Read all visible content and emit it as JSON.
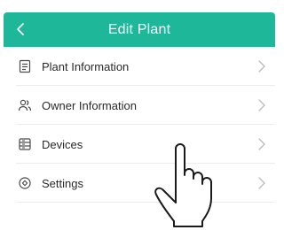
{
  "colors": {
    "accent": "#1fb79a",
    "icon": "#4a4a4a",
    "chevron": "#bdbdbd",
    "divider": "#ececec"
  },
  "header": {
    "title": "Edit Plant",
    "back_icon": "chevron-left-icon"
  },
  "menu": {
    "items": [
      {
        "label": "Plant Information",
        "icon": "document-icon"
      },
      {
        "label": "Owner Information",
        "icon": "users-icon"
      },
      {
        "label": "Devices",
        "icon": "device-icon"
      },
      {
        "label": "Settings",
        "icon": "settings-icon"
      }
    ]
  },
  "overlay": {
    "icon": "pointing-hand-icon"
  }
}
